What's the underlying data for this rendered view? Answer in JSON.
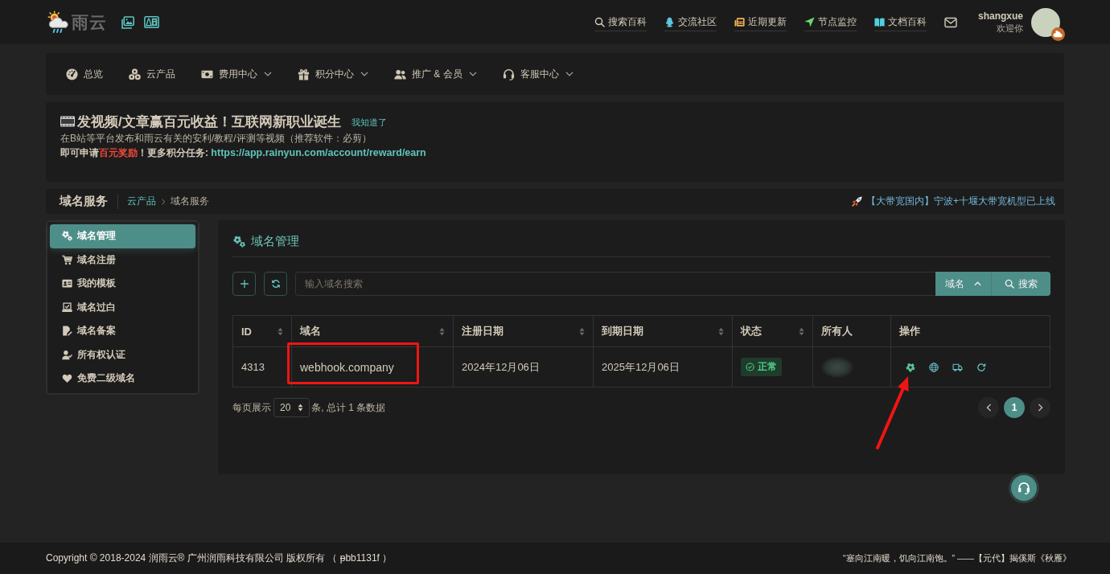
{
  "header": {
    "logo_text": "雨云",
    "nav": [
      {
        "label": "搜索百科"
      },
      {
        "label": "交流社区"
      },
      {
        "label": "近期更新"
      },
      {
        "label": "节点监控"
      },
      {
        "label": "文档百科"
      }
    ],
    "user": {
      "name": "shangxue",
      "greeting": "欢迎你"
    }
  },
  "menu": [
    {
      "label": "总览",
      "dropdown": false
    },
    {
      "label": "云产品",
      "dropdown": false
    },
    {
      "label": "费用中心",
      "dropdown": true
    },
    {
      "label": "积分中心",
      "dropdown": true
    },
    {
      "label": "推广 & 会员",
      "dropdown": true
    },
    {
      "label": "客服中心",
      "dropdown": true
    }
  ],
  "banner": {
    "title": "发视频/文章赢百元收益！互联网新职业诞生",
    "dismiss": "我知道了",
    "description": "在B站等平台发布和雨云有关的安利/教程/评测等视频（推荐软件：必剪）",
    "call_to_action": [
      {
        "kind": "text",
        "text": "即可申请"
      },
      {
        "kind": "highlight",
        "text": "百元奖励"
      },
      {
        "kind": "text",
        "text": "！更多积分任务: "
      },
      {
        "kind": "link",
        "text": "https://app.rainyun.com/account/reward/earn"
      }
    ]
  },
  "breadcrumb": {
    "title": "域名服务",
    "trail": [
      {
        "label": "云产品",
        "current": false
      },
      {
        "label": "域名服务",
        "current": true
      }
    ],
    "notice": "【大带宽国内】宁波+十堰大带宽机型已上线"
  },
  "sidebar": {
    "items": [
      {
        "label": "域名管理",
        "selected": true
      },
      {
        "label": "域名注册",
        "selected": false
      },
      {
        "label": "我的模板",
        "selected": false
      },
      {
        "label": "域名过白",
        "selected": false
      },
      {
        "label": "域名备案",
        "selected": false
      },
      {
        "label": "所有权认证",
        "selected": false
      },
      {
        "label": "免费二级域名",
        "selected": false
      }
    ]
  },
  "panel": {
    "title": "域名管理",
    "search": {
      "placeholder": "输入域名搜索"
    },
    "filter": "域名",
    "search_button": "搜索",
    "table": {
      "columns": [
        {
          "label": "ID",
          "sortable": true
        },
        {
          "label": "域名",
          "sortable": true
        },
        {
          "label": "注册日期",
          "sortable": true
        },
        {
          "label": "到期日期",
          "sortable": true
        },
        {
          "label": "状态",
          "sortable": true
        },
        {
          "label": "所有人",
          "sortable": false
        },
        {
          "label": "操作",
          "sortable": false
        }
      ],
      "rows": [
        {
          "id": "4313",
          "domain": "webhook.company",
          "domain_framed": true,
          "registered": "2024年12月06日",
          "expires": "2025年12月06日",
          "status": {
            "label": "正常",
            "kind": "normal"
          },
          "owner_redacted": true,
          "actions_pointed": true
        }
      ]
    },
    "pagination": {
      "label": "每页展示",
      "page_size": "20",
      "summary": "条, 总计 1 条数据",
      "pages": [
        {
          "label": "1",
          "selected": true
        }
      ]
    }
  },
  "footer": {
    "copyright": "Copyright © 2018-2024 润雨云® 广州润雨科技有限公司 版权所有 （ ᵽbb1131f ）",
    "quote": "“塞向江南暖，饥向江南饱。” ——【元代】揭傒斯《秋雁》"
  }
}
